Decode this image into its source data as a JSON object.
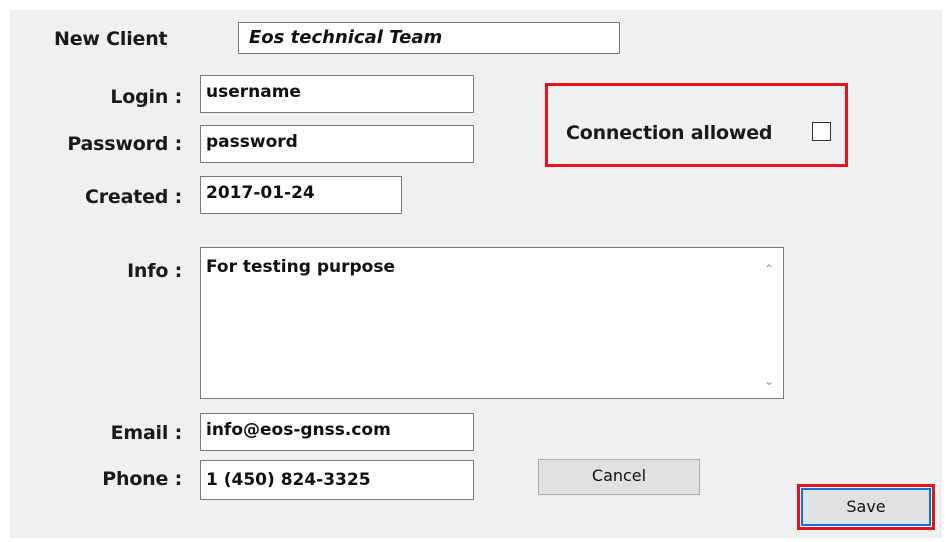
{
  "form": {
    "title_label": "New Client",
    "client_name": "Eos technical Team",
    "login_label": "Login :",
    "login_value": "username",
    "password_label": "Password :",
    "password_value": "password",
    "created_label": "Created :",
    "created_value": "2017-01-24",
    "info_label": "Info :",
    "info_value": "For testing purpose",
    "email_label": "Email :",
    "email_value": "info@eos-gnss.com",
    "phone_label": "Phone :",
    "phone_value": "1 (450) 824-3325",
    "connection_label": "Connection allowed",
    "connection_allowed": false
  },
  "buttons": {
    "cancel_label": "Cancel",
    "save_label": "Save"
  },
  "icons": {
    "scroll_up": "chevron-up-icon",
    "scroll_down": "chevron-down-icon"
  },
  "colors": {
    "highlight": "#e8121c",
    "panel_background": "#f0f0f0",
    "button_face": "#e1e1e1",
    "focus_border": "#0078d7"
  }
}
